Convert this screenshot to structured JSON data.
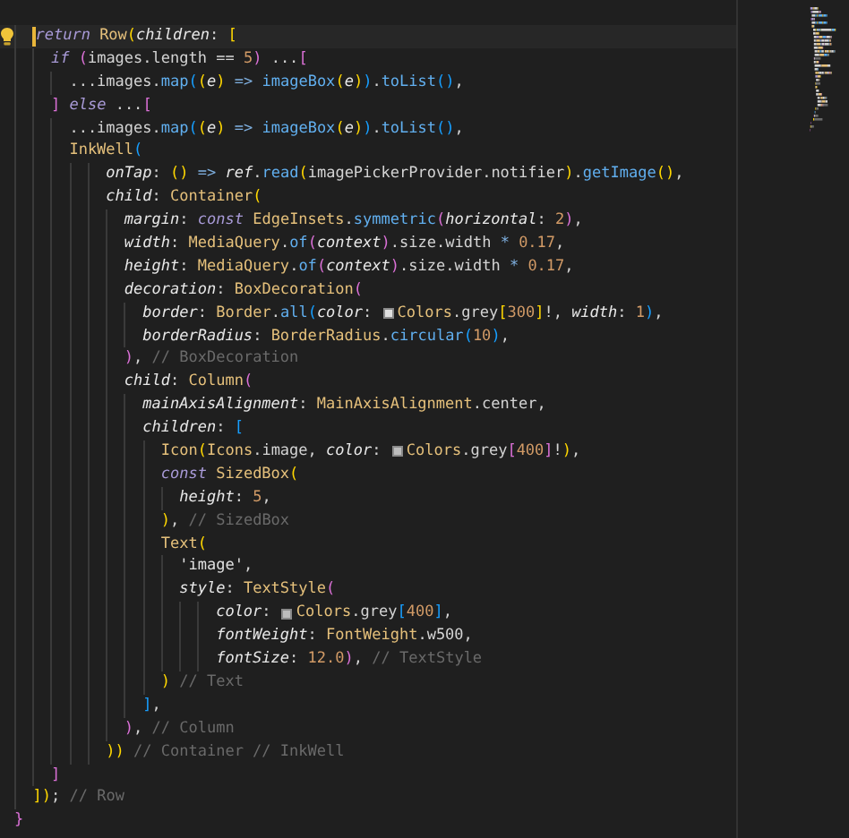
{
  "editor": {
    "lightbulb": true,
    "lines": [
      {
        "current": true,
        "tokens": [
          {
            "text": "  return ",
            "kind": "kw"
          },
          {
            "text": "Row",
            "kind": "type"
          },
          {
            "text": "(",
            "kind": "b1"
          },
          {
            "text": "children",
            "kind": "param"
          },
          {
            "text": ": "
          },
          {
            "text": "[",
            "kind": "b1"
          }
        ]
      },
      {
        "current": false,
        "tokens": [
          {
            "text": "    if ",
            "kind": "kw"
          },
          {
            "text": "(",
            "kind": "b2"
          },
          {
            "text": "images.length == "
          },
          {
            "text": "5",
            "kind": "num"
          },
          {
            "text": ")",
            "kind": "b2"
          },
          {
            "text": " ..."
          },
          {
            "text": "[",
            "kind": "b2"
          }
        ]
      },
      {
        "current": false,
        "tokens": [
          {
            "text": "      ...images."
          },
          {
            "text": "map",
            "kind": "fn"
          },
          {
            "text": "(",
            "kind": "b3"
          },
          {
            "text": "(",
            "kind": "b1"
          },
          {
            "text": "e",
            "kind": "param"
          },
          {
            "text": ")",
            "kind": "b1"
          },
          {
            "text": " => ",
            "kind": "op"
          },
          {
            "text": "imageBox",
            "kind": "fn"
          },
          {
            "text": "(",
            "kind": "b1"
          },
          {
            "text": "e",
            "kind": "param"
          },
          {
            "text": ")",
            "kind": "b1"
          },
          {
            "text": ")",
            "kind": "b3"
          },
          {
            "text": "."
          },
          {
            "text": "toList",
            "kind": "fn"
          },
          {
            "text": "()",
            "kind": "b3"
          },
          {
            "text": ","
          }
        ]
      },
      {
        "current": false,
        "tokens": [
          {
            "text": "    ] ",
            "kind": "b2"
          },
          {
            "text": "else",
            "kind": "kw"
          },
          {
            "text": " ..."
          },
          {
            "text": "[",
            "kind": "b2"
          }
        ]
      },
      {
        "current": false,
        "tokens": [
          {
            "text": "      ...images."
          },
          {
            "text": "map",
            "kind": "fn"
          },
          {
            "text": "(",
            "kind": "b3"
          },
          {
            "text": "(",
            "kind": "b1"
          },
          {
            "text": "e",
            "kind": "param"
          },
          {
            "text": ")",
            "kind": "b1"
          },
          {
            "text": " => ",
            "kind": "op"
          },
          {
            "text": "imageBox",
            "kind": "fn"
          },
          {
            "text": "(",
            "kind": "b1"
          },
          {
            "text": "e",
            "kind": "param"
          },
          {
            "text": ")",
            "kind": "b1"
          },
          {
            "text": ")",
            "kind": "b3"
          },
          {
            "text": "."
          },
          {
            "text": "toList",
            "kind": "fn"
          },
          {
            "text": "()",
            "kind": "b3"
          },
          {
            "text": ","
          }
        ]
      },
      {
        "current": false,
        "tokens": [
          {
            "text": "      InkWell",
            "kind": "type"
          },
          {
            "text": "(",
            "kind": "b3"
          }
        ]
      },
      {
        "current": false,
        "tokens": [
          {
            "text": "          onTap",
            "kind": "param"
          },
          {
            "text": ": "
          },
          {
            "text": "()",
            "kind": "b1"
          },
          {
            "text": " => ",
            "kind": "op"
          },
          {
            "text": "ref",
            "kind": "param"
          },
          {
            "text": "."
          },
          {
            "text": "read",
            "kind": "fn"
          },
          {
            "text": "(",
            "kind": "b1"
          },
          {
            "text": "imagePickerProvider.notifier"
          },
          {
            "text": ")",
            "kind": "b1"
          },
          {
            "text": "."
          },
          {
            "text": "getImage",
            "kind": "fn"
          },
          {
            "text": "()",
            "kind": "b1"
          },
          {
            "text": ","
          }
        ]
      },
      {
        "current": false,
        "tokens": [
          {
            "text": "          child",
            "kind": "param"
          },
          {
            "text": ": "
          },
          {
            "text": "Container",
            "kind": "type"
          },
          {
            "text": "(",
            "kind": "b1"
          }
        ]
      },
      {
        "current": false,
        "tokens": [
          {
            "text": "            margin",
            "kind": "param"
          },
          {
            "text": ": "
          },
          {
            "text": "const ",
            "kind": "kw"
          },
          {
            "text": "EdgeInsets",
            "kind": "type"
          },
          {
            "text": "."
          },
          {
            "text": "symmetric",
            "kind": "fn"
          },
          {
            "text": "(",
            "kind": "b2"
          },
          {
            "text": "horizontal",
            "kind": "param"
          },
          {
            "text": ": "
          },
          {
            "text": "2",
            "kind": "num"
          },
          {
            "text": ")",
            "kind": "b2"
          },
          {
            "text": ","
          }
        ]
      },
      {
        "current": false,
        "tokens": [
          {
            "text": "            width",
            "kind": "param"
          },
          {
            "text": ": "
          },
          {
            "text": "MediaQuery",
            "kind": "type"
          },
          {
            "text": "."
          },
          {
            "text": "of",
            "kind": "fn"
          },
          {
            "text": "(",
            "kind": "b2"
          },
          {
            "text": "context",
            "kind": "param"
          },
          {
            "text": ")",
            "kind": "b2"
          },
          {
            "text": ".size.width "
          },
          {
            "text": "* ",
            "kind": "op"
          },
          {
            "text": "0.17",
            "kind": "num"
          },
          {
            "text": ","
          }
        ]
      },
      {
        "current": false,
        "tokens": [
          {
            "text": "            height",
            "kind": "param"
          },
          {
            "text": ": "
          },
          {
            "text": "MediaQuery",
            "kind": "type"
          },
          {
            "text": "."
          },
          {
            "text": "of",
            "kind": "fn"
          },
          {
            "text": "(",
            "kind": "b2"
          },
          {
            "text": "context",
            "kind": "param"
          },
          {
            "text": ")",
            "kind": "b2"
          },
          {
            "text": ".size.width "
          },
          {
            "text": "* ",
            "kind": "op"
          },
          {
            "text": "0.17",
            "kind": "num"
          },
          {
            "text": ","
          }
        ]
      },
      {
        "current": false,
        "tokens": [
          {
            "text": "            decoration",
            "kind": "param"
          },
          {
            "text": ": "
          },
          {
            "text": "BoxDecoration",
            "kind": "type"
          },
          {
            "text": "(",
            "kind": "b2"
          }
        ]
      },
      {
        "current": false,
        "tokens": [
          {
            "text": "              border",
            "kind": "param"
          },
          {
            "text": ": "
          },
          {
            "text": "Border",
            "kind": "type"
          },
          {
            "text": "."
          },
          {
            "text": "all",
            "kind": "fn"
          },
          {
            "text": "(",
            "kind": "b3"
          },
          {
            "text": "color",
            "kind": "param"
          },
          {
            "text": ": "
          },
          {
            "kind": "swatch",
            "color": "#e0e0e0"
          },
          {
            "text": "Colors",
            "kind": "type"
          },
          {
            "text": ".grey"
          },
          {
            "text": "[",
            "kind": "b1"
          },
          {
            "text": "300",
            "kind": "num"
          },
          {
            "text": "]",
            "kind": "b1"
          },
          {
            "text": "!, "
          },
          {
            "text": "width",
            "kind": "param"
          },
          {
            "text": ": "
          },
          {
            "text": "1",
            "kind": "num"
          },
          {
            "text": ")",
            "kind": "b3"
          },
          {
            "text": ","
          }
        ]
      },
      {
        "current": false,
        "tokens": [
          {
            "text": "              borderRadius",
            "kind": "param"
          },
          {
            "text": ": "
          },
          {
            "text": "BorderRadius",
            "kind": "type"
          },
          {
            "text": "."
          },
          {
            "text": "circular",
            "kind": "fn"
          },
          {
            "text": "(",
            "kind": "b3"
          },
          {
            "text": "10",
            "kind": "num"
          },
          {
            "text": ")",
            "kind": "b3"
          },
          {
            "text": ","
          }
        ]
      },
      {
        "current": false,
        "tokens": [
          {
            "text": "            )",
            "kind": "b2"
          },
          {
            "text": ", "
          },
          {
            "text": "// BoxDecoration",
            "kind": "comment"
          }
        ]
      },
      {
        "current": false,
        "tokens": [
          {
            "text": "            child",
            "kind": "param"
          },
          {
            "text": ": "
          },
          {
            "text": "Column",
            "kind": "type"
          },
          {
            "text": "(",
            "kind": "b2"
          }
        ]
      },
      {
        "current": false,
        "tokens": [
          {
            "text": "              mainAxisAlignment",
            "kind": "param"
          },
          {
            "text": ": "
          },
          {
            "text": "MainAxisAlignment",
            "kind": "type"
          },
          {
            "text": ".center,"
          }
        ]
      },
      {
        "current": false,
        "tokens": [
          {
            "text": "              children",
            "kind": "param"
          },
          {
            "text": ": "
          },
          {
            "text": "[",
            "kind": "b3"
          }
        ]
      },
      {
        "current": false,
        "tokens": [
          {
            "text": "                Icon",
            "kind": "type"
          },
          {
            "text": "(",
            "kind": "b1"
          },
          {
            "text": "Icons",
            "kind": "type"
          },
          {
            "text": ".image, "
          },
          {
            "text": "color",
            "kind": "param"
          },
          {
            "text": ": "
          },
          {
            "kind": "swatch",
            "color": "#bdbdbd"
          },
          {
            "text": "Colors",
            "kind": "type"
          },
          {
            "text": ".grey"
          },
          {
            "text": "[",
            "kind": "b2"
          },
          {
            "text": "400",
            "kind": "num"
          },
          {
            "text": "]",
            "kind": "b2"
          },
          {
            "text": "!"
          },
          {
            "text": ")",
            "kind": "b1"
          },
          {
            "text": ","
          }
        ]
      },
      {
        "current": false,
        "tokens": [
          {
            "text": "                const ",
            "kind": "kw"
          },
          {
            "text": "SizedBox",
            "kind": "type"
          },
          {
            "text": "(",
            "kind": "b1"
          }
        ]
      },
      {
        "current": false,
        "tokens": [
          {
            "text": "                  height",
            "kind": "param"
          },
          {
            "text": ": "
          },
          {
            "text": "5",
            "kind": "num"
          },
          {
            "text": ","
          }
        ]
      },
      {
        "current": false,
        "tokens": [
          {
            "text": "                )",
            "kind": "b1"
          },
          {
            "text": ", "
          },
          {
            "text": "// SizedBox",
            "kind": "comment"
          }
        ]
      },
      {
        "current": false,
        "tokens": [
          {
            "text": "                Text",
            "kind": "type"
          },
          {
            "text": "(",
            "kind": "b1"
          }
        ]
      },
      {
        "current": false,
        "tokens": [
          {
            "text": "                  'image'",
            "kind": "str"
          },
          {
            "text": ","
          }
        ]
      },
      {
        "current": false,
        "tokens": [
          {
            "text": "                  style",
            "kind": "param"
          },
          {
            "text": ": "
          },
          {
            "text": "TextStyle",
            "kind": "type"
          },
          {
            "text": "(",
            "kind": "b2"
          }
        ]
      },
      {
        "current": false,
        "tokens": [
          {
            "text": "                      color",
            "kind": "param"
          },
          {
            "text": ": "
          },
          {
            "kind": "swatch",
            "color": "#bdbdbd"
          },
          {
            "text": "Colors",
            "kind": "type"
          },
          {
            "text": ".grey"
          },
          {
            "text": "[",
            "kind": "b3"
          },
          {
            "text": "400",
            "kind": "num"
          },
          {
            "text": "]",
            "kind": "b3"
          },
          {
            "text": ","
          }
        ]
      },
      {
        "current": false,
        "tokens": [
          {
            "text": "                      fontWeight",
            "kind": "param"
          },
          {
            "text": ": "
          },
          {
            "text": "FontWeight",
            "kind": "type"
          },
          {
            "text": ".w500,"
          }
        ]
      },
      {
        "current": false,
        "tokens": [
          {
            "text": "                      fontSize",
            "kind": "param"
          },
          {
            "text": ": "
          },
          {
            "text": "12.0",
            "kind": "num"
          },
          {
            "text": ")",
            "kind": "b2"
          },
          {
            "text": ", "
          },
          {
            "text": "// TextStyle",
            "kind": "comment"
          }
        ]
      },
      {
        "current": false,
        "tokens": [
          {
            "text": "                ) ",
            "kind": "b1"
          },
          {
            "text": "// Text",
            "kind": "comment"
          }
        ]
      },
      {
        "current": false,
        "tokens": [
          {
            "text": "              ]",
            "kind": "b3"
          },
          {
            "text": ","
          }
        ]
      },
      {
        "current": false,
        "tokens": [
          {
            "text": "            )",
            "kind": "b2"
          },
          {
            "text": ", "
          },
          {
            "text": "// Column",
            "kind": "comment"
          }
        ]
      },
      {
        "current": false,
        "tokens": [
          {
            "text": "          )) ",
            "kind": "b1"
          },
          {
            "text": "// Container // InkWell",
            "kind": "comment"
          }
        ]
      },
      {
        "current": false,
        "tokens": [
          {
            "text": "    ]",
            "kind": "b2"
          }
        ]
      },
      {
        "current": false,
        "tokens": [
          {
            "text": "  ]",
            "kind": "b1"
          },
          {
            "text": ")",
            "kind": "b1"
          },
          {
            "text": "; "
          },
          {
            "text": "// Row",
            "kind": "comment"
          }
        ]
      },
      {
        "current": false,
        "tokens": [
          {
            "text": "}",
            "kind": "b2"
          }
        ]
      }
    ]
  }
}
